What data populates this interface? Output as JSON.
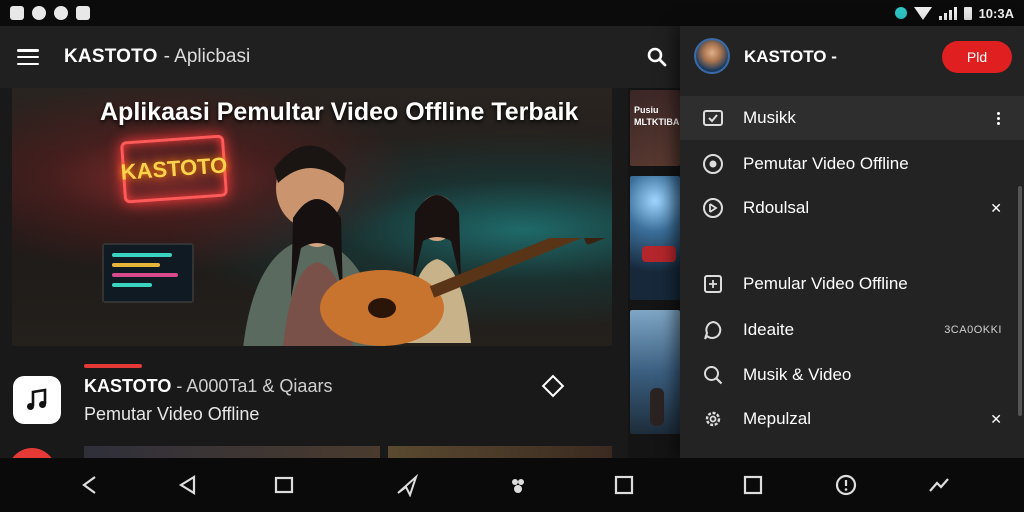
{
  "status_bar": {
    "time": "10:3A"
  },
  "app_bar": {
    "title": "KASTOTO",
    "subtitle": "- Aplicbasi"
  },
  "hero": {
    "title": "Aplikaasi Pemultar Video Offline Terbaik",
    "sign_text": "KASTOTO"
  },
  "featured_item": {
    "title_main": "KASTOTO",
    "title_rest": " - A000Ta1 & Qiaars",
    "subtitle": "Pemutar Video Offline"
  },
  "thumbnails": {
    "first_caption": "Pusiu\nMLTKTIBA"
  },
  "drawer": {
    "title": "KASTOTO -",
    "action_label": "Pld",
    "items": [
      {
        "label": "Musikk",
        "icon": "tablet-icon"
      },
      {
        "label": "Pemutar Video Offline",
        "icon": "compass-icon"
      },
      {
        "label": "Rdoulsal",
        "icon": "disc-icon"
      },
      {
        "label": "Pemular Video Offline",
        "icon": "film-icon"
      },
      {
        "label": "Ideaite",
        "icon": "chat-icon",
        "trailing": "3CA0OKKI"
      },
      {
        "label": "Musik & Video",
        "icon": "search-icon"
      },
      {
        "label": "Mepulzal",
        "icon": "gear-icon"
      }
    ]
  },
  "colors": {
    "accent": "#e53935",
    "drawer_bg": "#232323",
    "appbar_bg": "#202020"
  }
}
